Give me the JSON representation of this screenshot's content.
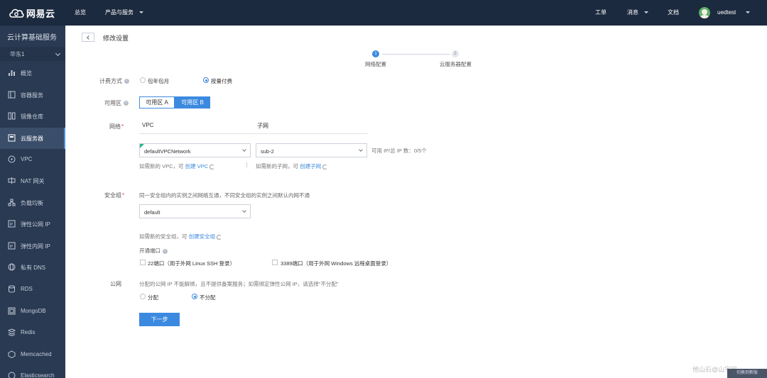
{
  "topbar": {
    "logo_text": "网易云",
    "nav": [
      {
        "label": "总览"
      },
      {
        "label": "产品与服务"
      }
    ],
    "right": [
      {
        "label": "工单"
      },
      {
        "label": "消息"
      },
      {
        "label": "文档"
      }
    ],
    "username": "uedtest"
  },
  "sidebar": {
    "title": "云计算基础服务",
    "region": "华东1",
    "items": [
      {
        "label": "概览",
        "icon": "bar-chart-icon"
      },
      {
        "label": "容器服务",
        "icon": "container-icon"
      },
      {
        "label": "镜像仓库",
        "icon": "image-repo-icon"
      },
      {
        "label": "云服务器",
        "icon": "server-icon"
      },
      {
        "label": "VPC",
        "icon": "vpc-icon"
      },
      {
        "label": "NAT 网关",
        "icon": "nat-icon"
      },
      {
        "label": "负载均衡",
        "icon": "load-balancer-icon"
      },
      {
        "label": "弹性公网 IP",
        "icon": "ip-icon"
      },
      {
        "label": "弹性内网 IP",
        "icon": "ip-icon"
      },
      {
        "label": "私有 DNS",
        "icon": "dns-icon"
      },
      {
        "label": "RDS",
        "icon": "database-icon"
      },
      {
        "label": "MongoDB",
        "icon": "mongodb-icon"
      },
      {
        "label": "Redis",
        "icon": "redis-icon"
      },
      {
        "label": "Memcached",
        "icon": "memcached-icon"
      },
      {
        "label": "Elasticsearch",
        "icon": "search-icon"
      }
    ],
    "active_index": 3
  },
  "page": {
    "title": "修改设置",
    "steps": [
      {
        "num": "1",
        "label": "网络配置",
        "active": true
      },
      {
        "num": "2",
        "label": "云服务器配置",
        "active": false
      }
    ]
  },
  "form": {
    "billing": {
      "label": "计费方式",
      "options": [
        "包年包月",
        "按量付费"
      ],
      "selected": "按量付费"
    },
    "zone": {
      "label": "可用区",
      "options": [
        "可用区 A",
        "可用区 B"
      ],
      "selected": "可用区 B"
    },
    "network": {
      "label": "网络",
      "vpc_header": "VPC",
      "subnet_header": "子网",
      "vpc_value": "defaultVPCNetwork",
      "subnet_value": "sub-2",
      "ip_count": "可用 IP/总 IP 数：0/5个",
      "vpc_hint": "如需新的 VPC，可",
      "vpc_link": "创建 VPC",
      "subnet_hint": "如需新的子网，可",
      "subnet_link": "创建子网"
    },
    "security": {
      "label": "安全组",
      "desc": "同一安全组内的实例之间网络互通，不同安全组的实例之间默认内网不通",
      "value": "default",
      "hint": "如需新的安全组，可",
      "link": "创建安全组",
      "ports_label": "开通端口",
      "ports": [
        "22端口（用于外网 Linux SSH 登录）",
        "3389端口（用于外网 Windows 远程桌面登录）"
      ]
    },
    "public_ip": {
      "label": "公网",
      "desc": "分配的公网 IP 不能解绑，且不提供备案服务；如需绑定弹性公网 IP，请选择\"不分配\"",
      "options": [
        "分配",
        "不分配"
      ],
      "selected": "不分配"
    },
    "next_label": "下一步"
  },
  "watermark": "他山石@山宇肩",
  "corner_badge": "切换到新版"
}
